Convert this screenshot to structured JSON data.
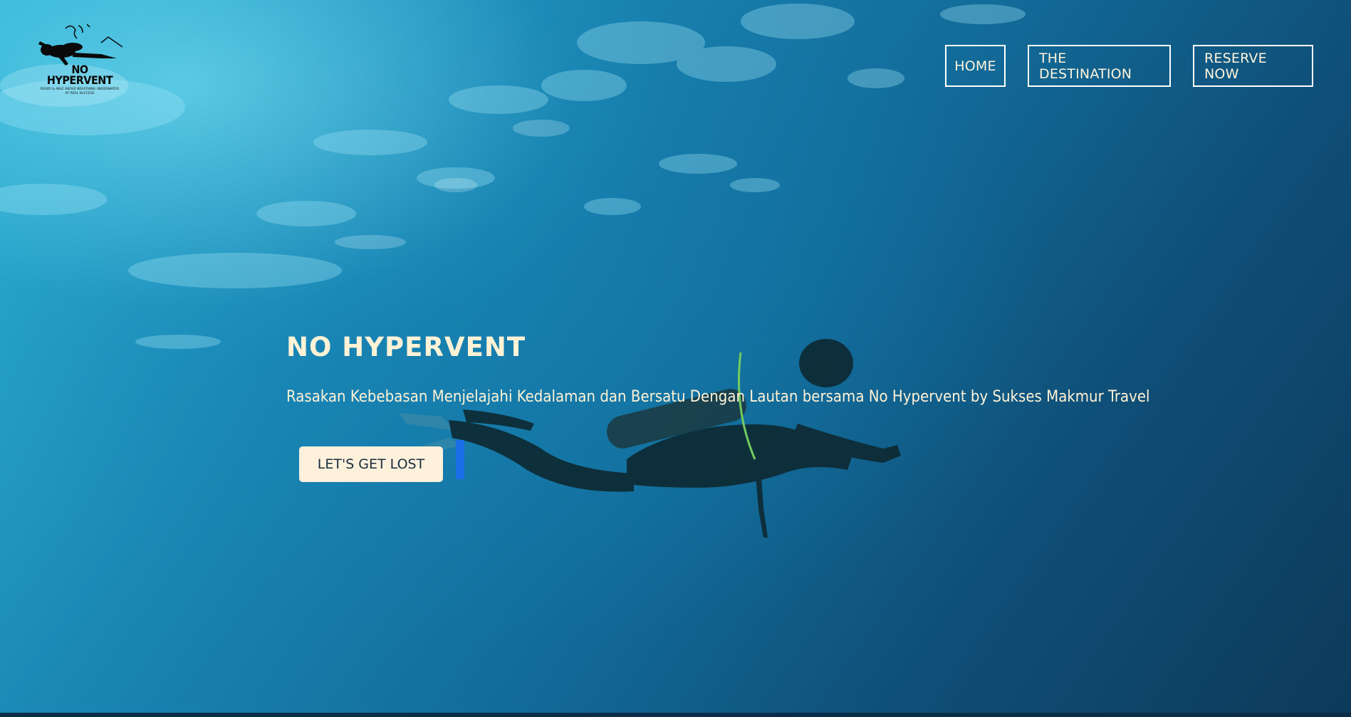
{
  "logo": {
    "title_line1": "NO",
    "title_line2": "HYPERVENT",
    "tagline": "READY & ABLE ABOVE BREATHING UNDERWATER AT REAL SUCCESS"
  },
  "nav": {
    "items": [
      {
        "label": "HOME"
      },
      {
        "label": "THE DESTINATION"
      },
      {
        "label": "RESERVE NOW"
      }
    ]
  },
  "hero": {
    "title": "NO HYPERVENT",
    "subtitle": "Rasakan Kebebasan Menjelajahi Kedalaman dan Bersatu Dengan Lautan bersama No Hypervent by Sukses Makmur Travel",
    "cta_label": "LET'S GET LOST"
  },
  "colors": {
    "text_cream": "#fff2d6",
    "button_bg": "#fdf1dc",
    "water_light": "#2db3d6",
    "water_deep": "#0d3a5a",
    "cursor_blue": "#1a6ee6"
  }
}
